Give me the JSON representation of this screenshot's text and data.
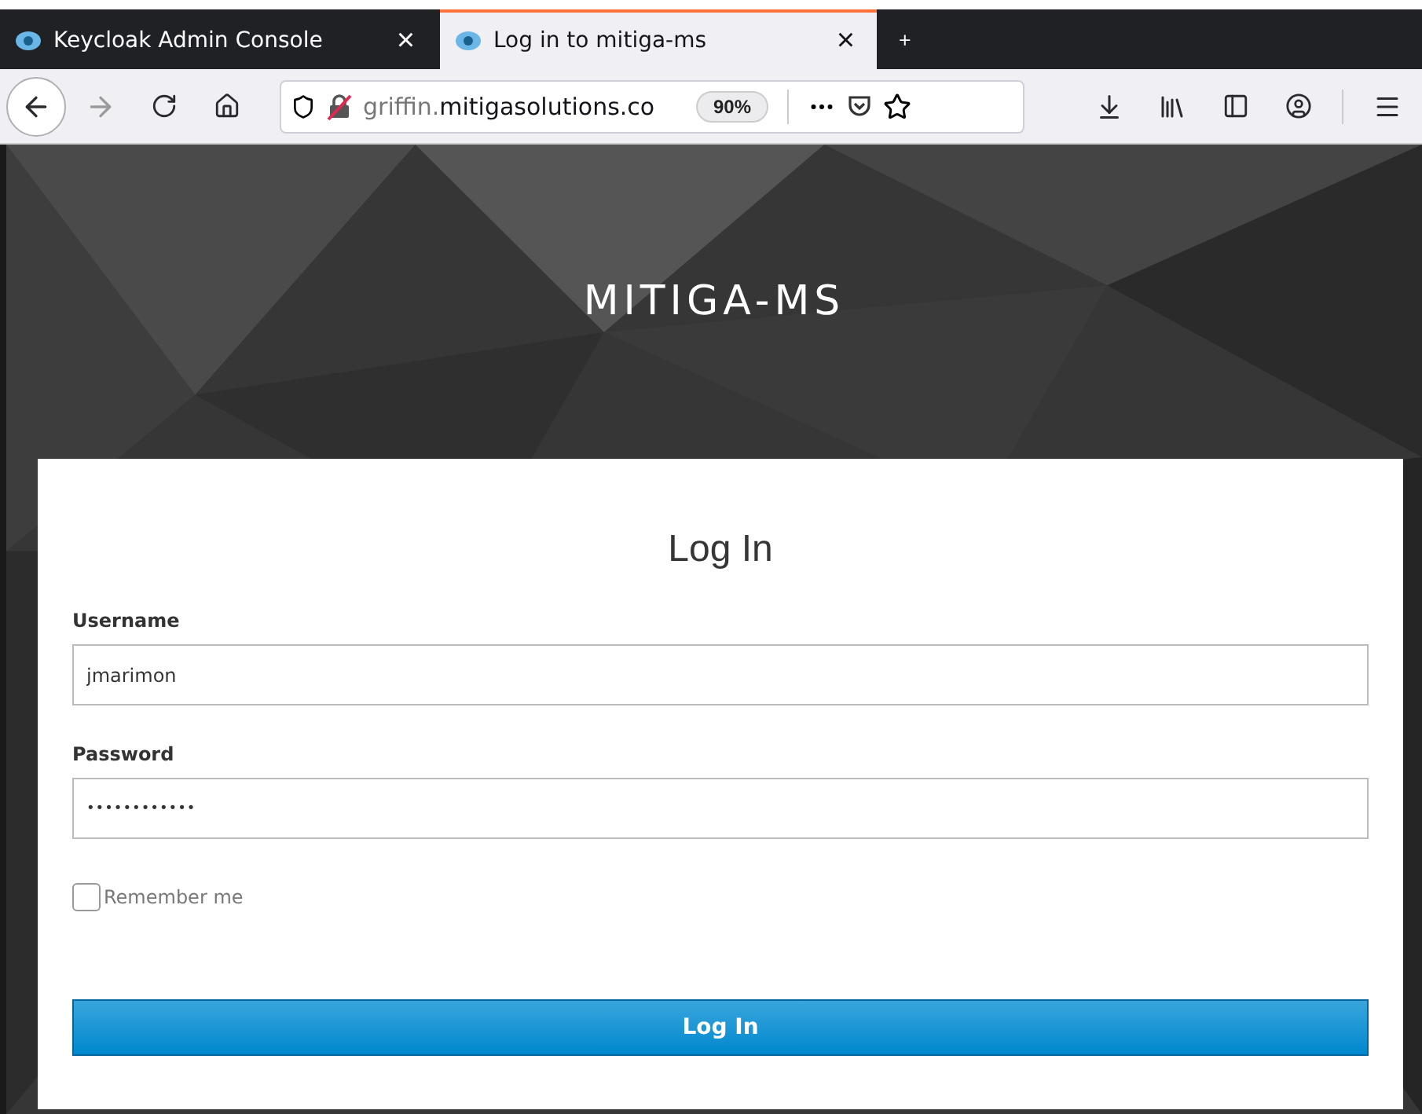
{
  "tabs": [
    {
      "title": "Keycloak Admin Console",
      "close": "×",
      "selected": false
    },
    {
      "title": "Log in to mitiga-ms",
      "close": "×",
      "selected": true
    }
  ],
  "new_tab": "+",
  "address_bar": {
    "subdomain": "griffin.",
    "domain": "mitigasolutions.co",
    "zoom": "90%"
  },
  "realm_title": "MITIGA-MS",
  "login": {
    "heading": "Log In",
    "fields": [
      {
        "label": "Username",
        "value": "jmarimon",
        "kind": "text"
      },
      {
        "label": "Password",
        "value": "••••••••••••",
        "kind": "password"
      }
    ],
    "remember_me": {
      "label": "Remember me",
      "checked": false
    },
    "submit": "Log In"
  }
}
